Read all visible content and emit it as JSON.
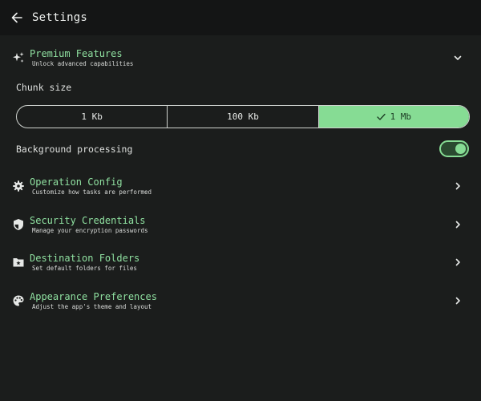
{
  "header": {
    "title": "Settings",
    "back_icon": "arrow-left-icon"
  },
  "premium": {
    "title": "Premium Features",
    "subtitle": "Unlock advanced capabilities",
    "icon": "sparkles-icon",
    "expanded": true
  },
  "chunk_size": {
    "label": "Chunk size",
    "options": [
      "1 Kb",
      "100 Kb",
      "1 Mb"
    ],
    "selected": "1 Mb"
  },
  "background_processing": {
    "label": "Background processing",
    "enabled": true
  },
  "menu": [
    {
      "title": "Operation Config",
      "subtitle": "Customize how tasks are performed",
      "icon": "gear-icon"
    },
    {
      "title": "Security Credentials",
      "subtitle": "Manage your encryption passwords",
      "icon": "shield-icon"
    },
    {
      "title": "Destination Folders",
      "subtitle": "Set default folders for files",
      "icon": "folder-star-icon"
    },
    {
      "title": "Appearance Preferences",
      "subtitle": "Adjust the app's theme and layout",
      "icon": "palette-icon"
    }
  ],
  "colors": {
    "accent": "#86dc94",
    "background": "#1b1d1c",
    "topbar": "#141515"
  }
}
